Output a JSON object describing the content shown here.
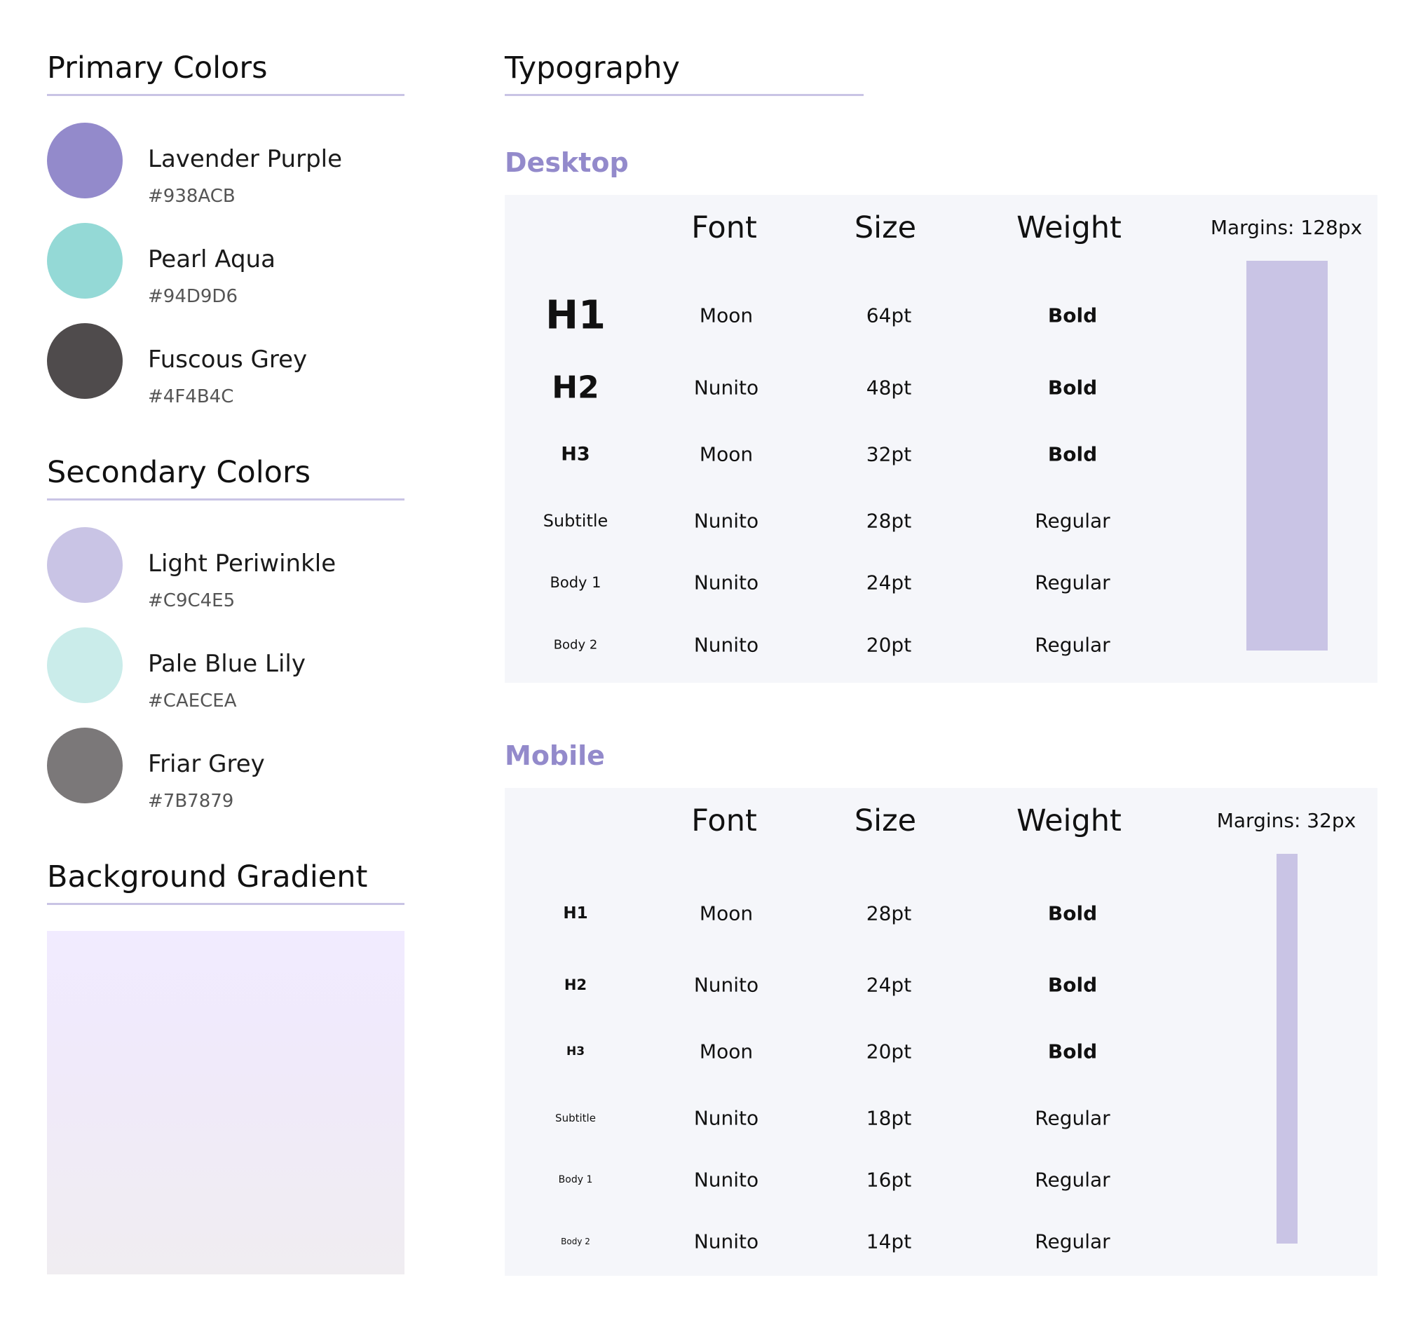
{
  "primary": {
    "title": "Primary Colors",
    "colors": [
      {
        "name": "Lavender Purple",
        "hex": "#938ACB",
        "color": "#938acb"
      },
      {
        "name": "Pearl Aqua",
        "hex": "#94D9D6",
        "color": "#94d9d6"
      },
      {
        "name": "Fuscous Grey",
        "hex": "#4F4B4C",
        "color": "#4f4b4c"
      }
    ]
  },
  "secondary": {
    "title": "Secondary Colors",
    "colors": [
      {
        "name": "Light Periwinkle",
        "hex": "#C9C4E5",
        "color": "#c9c4e5"
      },
      {
        "name": "Pale Blue Lily",
        "hex": "#CAECEA",
        "color": "#caecea"
      },
      {
        "name": "Friar Grey",
        "hex": "#7B7879",
        "color": "#7b7879"
      }
    ]
  },
  "gradient": {
    "title": "Background Gradient",
    "color_top": "#f1ebff",
    "color_bottom": "#f0edf1"
  },
  "typography": {
    "title": "Typography",
    "headers": {
      "font": "Font",
      "size": "Size",
      "weight": "Weight"
    },
    "desktop": {
      "title": "Desktop",
      "margins": "Margins: 128px",
      "rows": [
        {
          "style": "H1",
          "font": "Moon",
          "size": "64pt",
          "weight": "Bold"
        },
        {
          "style": "H2",
          "font": "Nunito",
          "size": "48pt",
          "weight": "Bold"
        },
        {
          "style": "H3",
          "font": "Moon",
          "size": "32pt",
          "weight": "Bold"
        },
        {
          "style": "Subtitle",
          "font": "Nunito",
          "size": "28pt",
          "weight": "Regular"
        },
        {
          "style": "Body 1",
          "font": "Nunito",
          "size": "24pt",
          "weight": "Regular"
        },
        {
          "style": "Body 2",
          "font": "Nunito",
          "size": "20pt",
          "weight": "Regular"
        }
      ]
    },
    "mobile": {
      "title": "Mobile",
      "margins": "Margins: 32px",
      "rows": [
        {
          "style": "H1",
          "font": "Moon",
          "size": "28pt",
          "weight": "Bold"
        },
        {
          "style": "H2",
          "font": "Nunito",
          "size": "24pt",
          "weight": "Bold"
        },
        {
          "style": "H3",
          "font": "Moon",
          "size": "20pt",
          "weight": "Bold"
        },
        {
          "style": "Subtitle",
          "font": "Nunito",
          "size": "18pt",
          "weight": "Regular"
        },
        {
          "style": "Body 1",
          "font": "Nunito",
          "size": "16pt",
          "weight": "Regular"
        },
        {
          "style": "Body 2",
          "font": "Nunito",
          "size": "14pt",
          "weight": "Regular"
        }
      ]
    }
  }
}
